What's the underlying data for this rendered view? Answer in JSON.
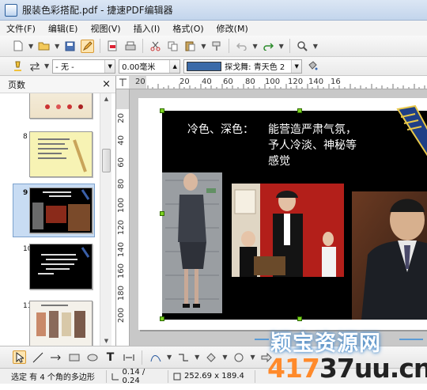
{
  "window": {
    "title": "服装色彩搭配.pdf - 捷速PDF编辑器"
  },
  "menu": [
    "文件(F)",
    "编辑(E)",
    "视图(V)",
    "插入(I)",
    "格式(O)",
    "修改(M)"
  ],
  "toolbar2": {
    "line_style_value": "- 无 -",
    "line_width_value": "0.00毫米",
    "fill_color_value": "探戈舞: 青天色 2"
  },
  "pages_panel": {
    "title": "页数",
    "close_label": "×",
    "thumbnails": [
      {
        "number": "",
        "kind": "partial"
      },
      {
        "number": "8",
        "kind": "yellow"
      },
      {
        "number": "9",
        "kind": "dark-photos",
        "selected": true
      },
      {
        "number": "10",
        "kind": "dark-text"
      },
      {
        "number": "11",
        "kind": "light-photos"
      }
    ]
  },
  "ruler": {
    "top_labels": [
      "20",
      "20",
      "40",
      "60",
      "80",
      "100",
      "120",
      "140",
      "16"
    ],
    "left_labels": [
      "20",
      "40",
      "60",
      "80",
      "100",
      "120",
      "140",
      "160",
      "180",
      "200"
    ]
  },
  "slide": {
    "label": "冷色、深色：",
    "text_lines": [
      "能营造严肃气氛，",
      "予人冷淡、神秘等",
      "感觉"
    ]
  },
  "status": {
    "selection": "选定 有 4 个角的多边形",
    "position": "0.14 / 0.24",
    "size": "252.69 x 189.4"
  },
  "watermark": {
    "line1": "颖宝资源网",
    "line2_prefix": "417",
    "line2_main": "37uu.cn"
  },
  "colors": {
    "selection_highlight": "#c8dcf3",
    "fill_swatch": "#3b6aa8",
    "handle": "#7ed321",
    "watermark_orange": "#ff8a2b"
  }
}
